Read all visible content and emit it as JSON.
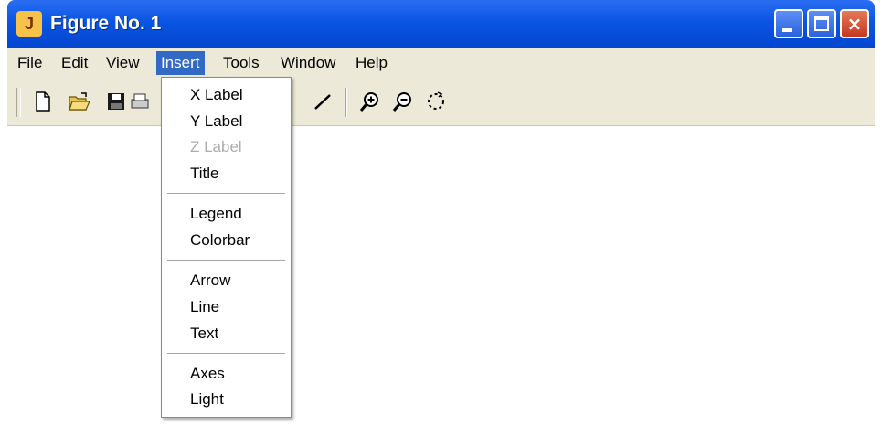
{
  "window": {
    "title": "Figure No. 1",
    "app_icon_glyph": "J"
  },
  "titlebar_buttons": {
    "minimize_icon": "minimize-icon",
    "maximize_icon": "maximize-icon",
    "close_icon": "close-icon",
    "close_glyph": "×"
  },
  "menubar": {
    "items": [
      "File",
      "Edit",
      "View",
      "Insert",
      "Tools",
      "Window",
      "Help"
    ],
    "active": "Insert"
  },
  "toolbar": {
    "icons": [
      "new-file-icon",
      "open-folder-icon",
      "save-icon",
      "print-icon",
      "arrow-icon",
      "line-icon",
      "zoom-in-icon",
      "zoom-out-icon",
      "rotate-icon"
    ]
  },
  "insert_menu": {
    "groups": [
      {
        "items": [
          {
            "label": "X Label",
            "enabled": true
          },
          {
            "label": "Y Label",
            "enabled": true
          },
          {
            "label": "Z Label",
            "enabled": false
          },
          {
            "label": "Title",
            "enabled": true
          }
        ]
      },
      {
        "items": [
          {
            "label": "Legend",
            "enabled": true
          },
          {
            "label": "Colorbar",
            "enabled": true
          }
        ]
      },
      {
        "items": [
          {
            "label": "Arrow",
            "enabled": true
          },
          {
            "label": "Line",
            "enabled": true
          },
          {
            "label": "Text",
            "enabled": true
          }
        ]
      },
      {
        "items": [
          {
            "label": "Axes",
            "enabled": true
          },
          {
            "label": "Light",
            "enabled": true
          }
        ]
      }
    ]
  },
  "colors": {
    "titlebar": "#0a55e3",
    "menu_highlight": "#316ac5",
    "chrome": "#ece9d8",
    "disabled_text": "#adadad"
  }
}
